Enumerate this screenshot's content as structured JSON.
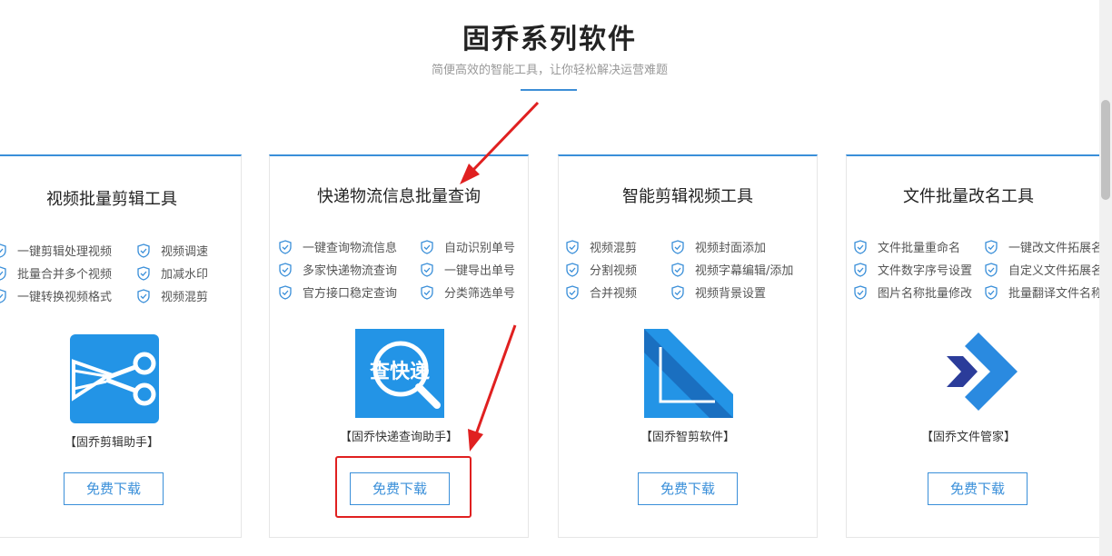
{
  "header": {
    "title": "固乔系列软件",
    "subtitle": "简便高效的智能工具，让你轻松解决运营难题"
  },
  "colors": {
    "accent": "#3a8fd9",
    "annotation": "#e02020"
  },
  "cards": [
    {
      "title": "视频批量剪辑工具",
      "features": [
        "一键剪辑处理视频",
        "视频调速",
        "批量合并多个视频",
        "加减水印",
        "一键转换视频格式",
        "视频混剪"
      ],
      "product_name": "【固乔剪辑助手】",
      "download_label": "免费下载",
      "logo_icon": "scissors-icon"
    },
    {
      "title": "快递物流信息批量查询",
      "features": [
        "一键查询物流信息",
        "自动识别单号",
        "多家快递物流查询",
        "一键导出单号",
        "官方接口稳定查询",
        "分类筛选单号"
      ],
      "product_name": "【固乔快递查询助手】",
      "logo_text": "查快递",
      "download_label": "免费下载",
      "logo_icon": "express-search-icon"
    },
    {
      "title": "智能剪辑视频工具",
      "features": [
        "视频混剪",
        "视频封面添加",
        "分割视频",
        "视频字幕编辑/添加",
        "合并视频",
        "视频背景设置"
      ],
      "product_name": "【固乔智剪软件】",
      "download_label": "免费下载",
      "logo_icon": "smart-clip-icon"
    },
    {
      "title": "文件批量改名工具",
      "features": [
        "文件批量重命名",
        "一键改文件拓展名",
        "文件数字序号设置",
        "自定义文件拓展名",
        "图片名称批量修改",
        "批量翻译文件名称"
      ],
      "product_name": "【固乔文件管家】",
      "download_label": "免费下载",
      "logo_icon": "file-manager-icon"
    }
  ]
}
